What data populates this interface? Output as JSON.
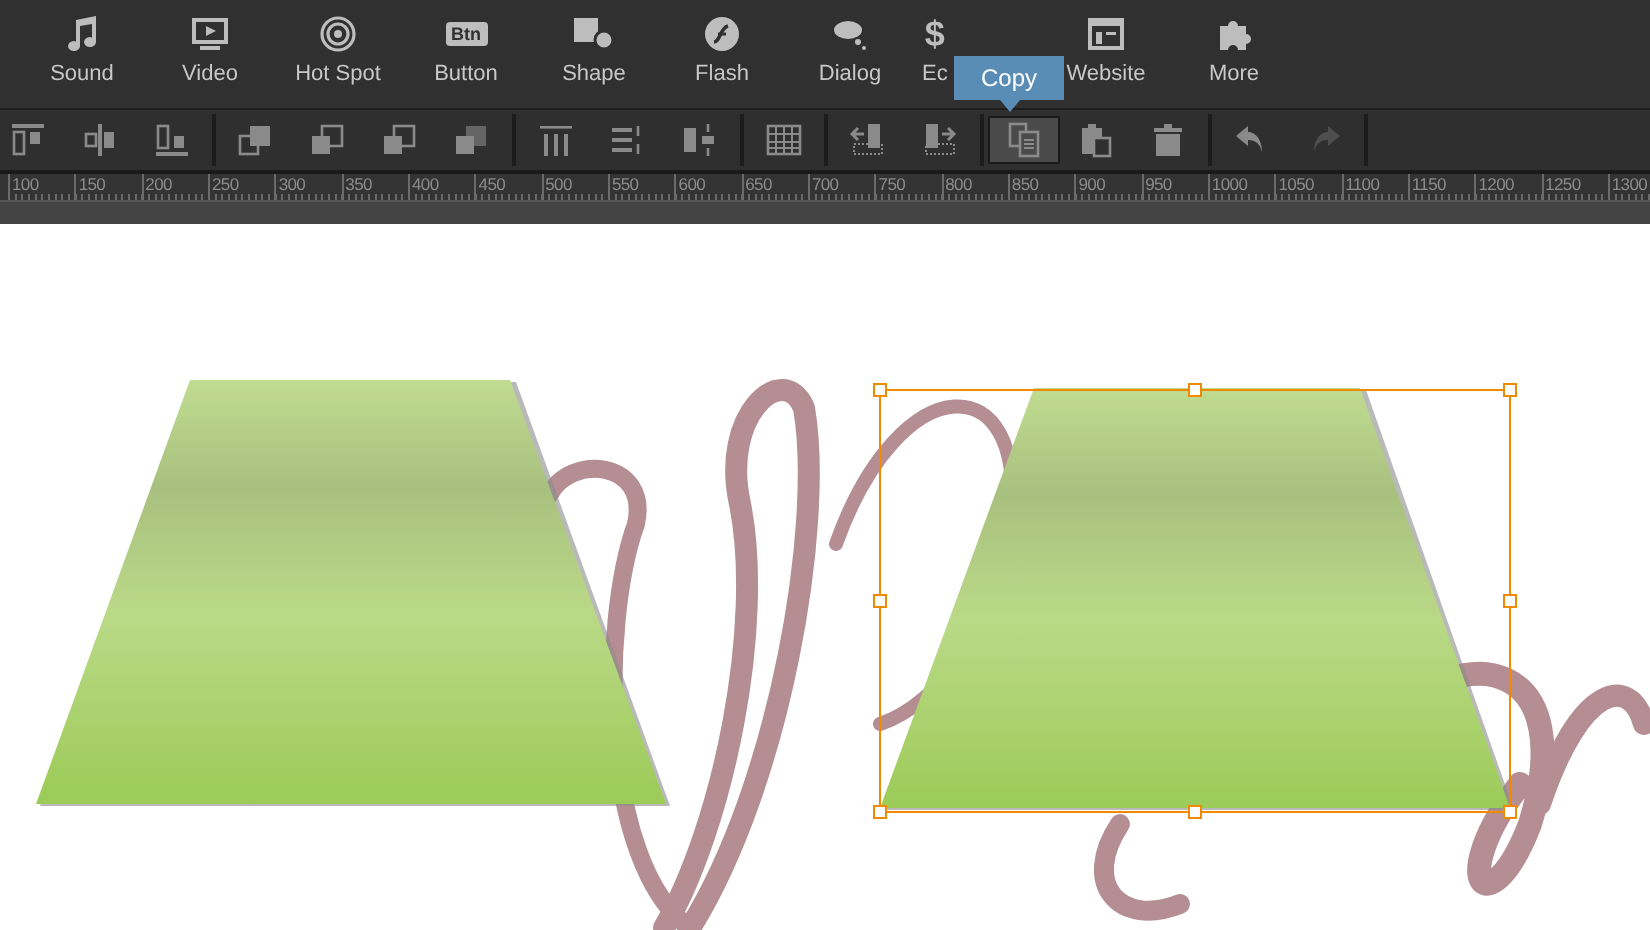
{
  "main_toolbar": [
    {
      "label": "Sound"
    },
    {
      "label": "Video"
    },
    {
      "label": "Hot Spot"
    },
    {
      "label": "Button",
      "badge": "Btn"
    },
    {
      "label": "Shape"
    },
    {
      "label": "Flash"
    },
    {
      "label": "Dialog"
    },
    {
      "label": "Ec",
      "glyph": "$"
    },
    {
      "label": "Website"
    },
    {
      "label": "More"
    }
  ],
  "tooltip": {
    "text": "Copy"
  },
  "edit_toolbar": [
    [
      {
        "kind": "align-top",
        "selected": false,
        "disabled": false
      },
      {
        "kind": "align-middle",
        "selected": false,
        "disabled": false
      },
      {
        "kind": "align-bottom",
        "selected": false,
        "disabled": false
      }
    ],
    [
      {
        "kind": "bring-front",
        "selected": false,
        "disabled": false
      },
      {
        "kind": "bring-forward",
        "selected": false,
        "disabled": false
      },
      {
        "kind": "send-backward",
        "selected": false,
        "disabled": false
      },
      {
        "kind": "send-back",
        "selected": false,
        "disabled": false
      }
    ],
    [
      {
        "kind": "distribute",
        "selected": false,
        "disabled": false
      },
      {
        "kind": "spacing",
        "selected": false,
        "disabled": false
      },
      {
        "kind": "resize",
        "selected": false,
        "disabled": false
      }
    ],
    [
      {
        "kind": "grid",
        "selected": false,
        "disabled": false
      }
    ],
    [
      {
        "kind": "move-in",
        "selected": false,
        "disabled": false
      },
      {
        "kind": "move-out",
        "selected": false,
        "disabled": false
      }
    ],
    [
      {
        "kind": "copy",
        "selected": true,
        "disabled": false
      },
      {
        "kind": "paste",
        "selected": false,
        "disabled": false
      },
      {
        "kind": "delete",
        "selected": false,
        "disabled": false
      }
    ],
    [
      {
        "kind": "undo",
        "selected": false,
        "disabled": false
      },
      {
        "kind": "redo",
        "selected": false,
        "disabled": true
      }
    ]
  ],
  "ruler": [
    "100",
    "150",
    "200",
    "250",
    "300",
    "350",
    "400",
    "450",
    "500",
    "550",
    "600",
    "650",
    "700",
    "750",
    "800",
    "850",
    "900",
    "950",
    "1000",
    "1050",
    "1100",
    "1150",
    "1200",
    "1250",
    "1300"
  ],
  "canvas": {
    "shapes": [
      {
        "selected": false
      },
      {
        "selected": true
      }
    ]
  }
}
